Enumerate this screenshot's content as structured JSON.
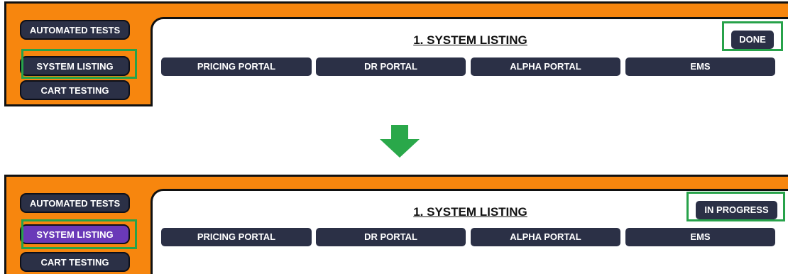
{
  "top_panel": {
    "sidebar": {
      "automated_tests": "AUTOMATED TESTS",
      "system_listing": "SYSTEM LISTING",
      "cart_testing": "CART TESTING"
    },
    "title": "1. SYSTEM LISTING",
    "status": "DONE",
    "tabs": [
      "PRICING PORTAL",
      "DR PORTAL",
      "ALPHA PORTAL",
      "EMS"
    ]
  },
  "bottom_panel": {
    "sidebar": {
      "automated_tests": "AUTOMATED TESTS",
      "system_listing": "SYSTEM LISTING",
      "cart_testing": "CART TESTING"
    },
    "title": "1. SYSTEM LISTING",
    "status": "IN PROGRESS",
    "tabs": [
      "PRICING PORTAL",
      "DR PORTAL",
      "ALPHA PORTAL",
      "EMS"
    ]
  },
  "colors": {
    "panel_orange": "#f7860e",
    "button_navy": "#2b3046",
    "active_purple": "#6a39b8",
    "highlight_green": "#27a24a",
    "arrow_green": "#2aa84a"
  },
  "icons": {
    "transition_arrow": "arrow-down-icon"
  }
}
